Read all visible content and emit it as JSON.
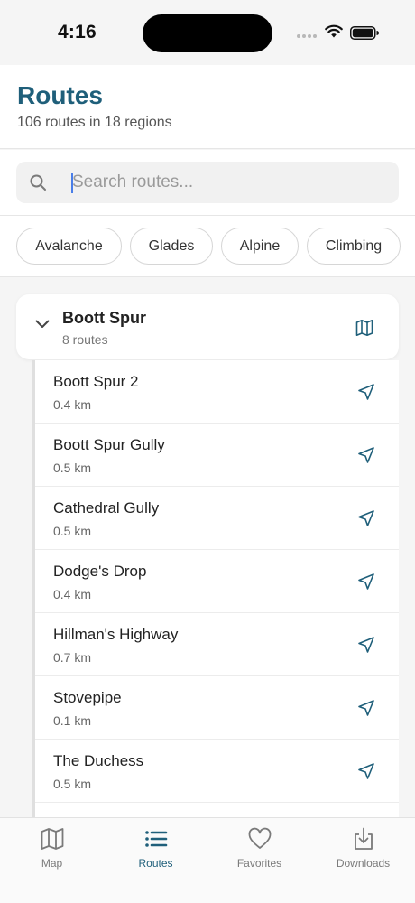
{
  "status_bar": {
    "time": "4:16"
  },
  "header": {
    "title": "Routes",
    "subtitle": "106 routes in 18 regions"
  },
  "search": {
    "placeholder": "Search routes...",
    "value": ""
  },
  "filters": [
    "Avalanche",
    "Glades",
    "Alpine",
    "Climbing"
  ],
  "region": {
    "name": "Boott Spur",
    "count_label": "8 routes",
    "expanded": true
  },
  "routes": [
    {
      "name": "Boott Spur 2",
      "distance": "0.4 km"
    },
    {
      "name": "Boott Spur Gully",
      "distance": "0.5 km"
    },
    {
      "name": "Cathedral Gully",
      "distance": "0.5 km"
    },
    {
      "name": "Dodge's Drop",
      "distance": "0.4 km"
    },
    {
      "name": "Hillman's Highway",
      "distance": "0.7 km"
    },
    {
      "name": "Stovepipe",
      "distance": "0.1 km"
    },
    {
      "name": "The Duchess",
      "distance": "0.5 km"
    }
  ],
  "tabs": [
    {
      "label": "Map",
      "icon": "map-icon",
      "active": false
    },
    {
      "label": "Routes",
      "icon": "list-icon",
      "active": true
    },
    {
      "label": "Favorites",
      "icon": "heart-icon",
      "active": false
    },
    {
      "label": "Downloads",
      "icon": "download-icon",
      "active": false
    }
  ],
  "colors": {
    "accent": "#1f5f7a",
    "background": "#f5f5f5",
    "inactive_tab": "#7a7a7a"
  }
}
